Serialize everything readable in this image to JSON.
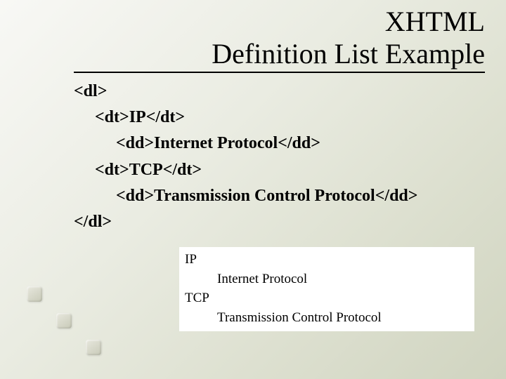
{
  "title": {
    "line1": "XHTML",
    "line2": "Definition List Example"
  },
  "code": {
    "l1": "<dl>",
    "l2": "<dt>IP</dt>",
    "l3": "<dd>Internet Protocol</dd>",
    "l4": "<dt>TCP</dt>",
    "l5": "<dd>Transmission Control Protocol</dd>",
    "l6": "</dl>"
  },
  "output": {
    "dt1": "IP",
    "dd1": "Internet Protocol",
    "dt2": "TCP",
    "dd2": "Transmission Control Protocol"
  }
}
